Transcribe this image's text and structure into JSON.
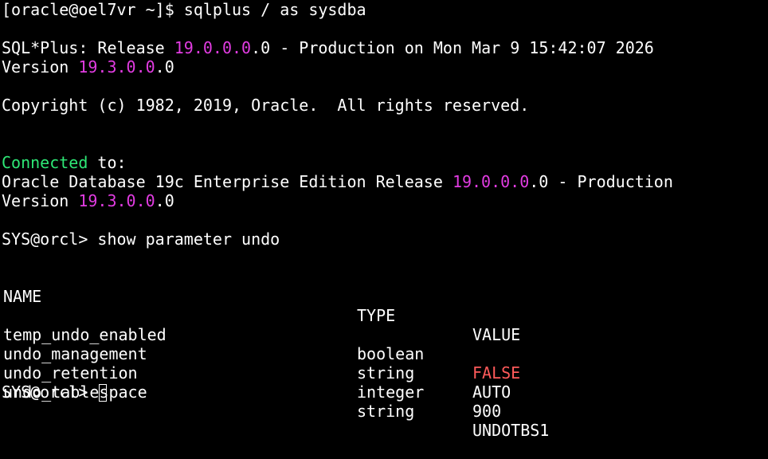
{
  "colors": {
    "background": "#000000",
    "text": "#ffffff",
    "version_highlight": "#e23ce2",
    "connected": "#2ee876",
    "dash_blue": "#3aa0e8",
    "false_red": "#ff5a5a"
  },
  "lines": {
    "prompt_cmd": "[oracle@oel7vr ~]$ sqlplus / as sysdba",
    "sqlplus_prefix": "SQL*Plus: Release ",
    "sqlplus_ver_hi": "19.0.0.0",
    "sqlplus_ver_tail": ".0",
    "sqlplus_suffix": " - Production on Mon Mar 9 15:42:07 2026",
    "version_prefix": "Version ",
    "version_hi": "19.3.0.0",
    "version_tail": ".0",
    "copyright": "Copyright (c) 1982, 2019, Oracle.  All rights reserved.",
    "connected_word": "Connected",
    "connected_rest": " to:",
    "db_prefix": "Oracle Database 19c Enterprise Edition Release ",
    "db_ver_hi": "19.0.0.0",
    "db_ver_tail": ".0",
    "db_suffix": " - Production",
    "version2_prefix": "Version ",
    "version2_hi": "19.3.0.0",
    "version2_tail": ".0",
    "sql_prompt_cmd": "SYS@orcl> show parameter undo",
    "final_prompt": "SYS@orcl> "
  },
  "table": {
    "headers": [
      "NAME",
      "TYPE",
      "VALUE"
    ],
    "rule_name": "------------------------------------",
    "rule_type": "-----------",
    "rule_value": "------------------------------",
    "rows": [
      {
        "name": "temp_undo_enabled",
        "type": "boolean",
        "value": "FALSE"
      },
      {
        "name": "undo_management",
        "type": "string",
        "value": "AUTO"
      },
      {
        "name": "undo_retention",
        "type": "integer",
        "value": "900"
      },
      {
        "name": "undo_tablespace",
        "type": "string",
        "value": "UNDOTBS1"
      }
    ]
  }
}
